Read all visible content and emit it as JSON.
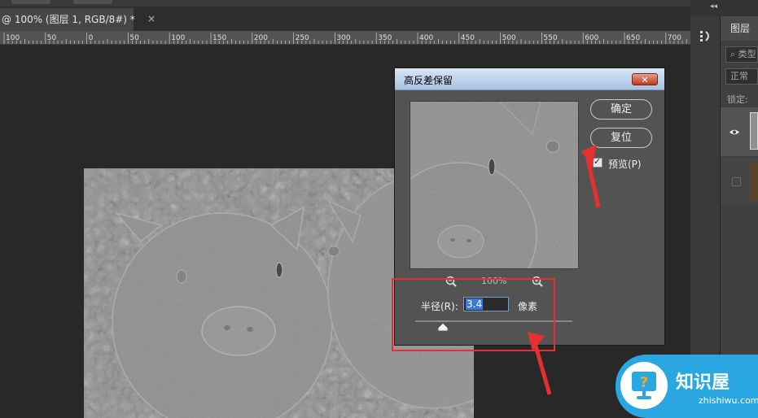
{
  "document": {
    "tab_label": "@ 100% (图层 1, RGB/8#) *",
    "close_glyph": "×"
  },
  "ruler": {
    "ticks": [
      "100",
      "50",
      "0",
      "50",
      "100",
      "150",
      "200",
      "250",
      "300",
      "350",
      "400",
      "450",
      "500",
      "550",
      "600",
      "650",
      "700"
    ]
  },
  "right_panel": {
    "collapse_glyph": "◂◂",
    "tab_label": "图层",
    "search_placeholder": "类型",
    "blend_mode": "正常",
    "lock_label": "锁定:"
  },
  "dialog": {
    "title": "高反差保留",
    "close_glyph": "✕",
    "ok_label": "确定",
    "reset_label": "复位",
    "preview_label": "预览(P)",
    "preview_checked": true,
    "zoom_level": "100%",
    "radius_label": "半径(R):",
    "radius_value": "3.4",
    "radius_unit": "像素",
    "slider_level": 0.17
  },
  "watermark": {
    "brand": "知识屋",
    "site": "zhishiwu.com"
  },
  "colors": {
    "canvas_bg": "#282828",
    "dialog_bg": "#535353",
    "titlebar": "#bcd3ee",
    "annotation_red": "#e53030",
    "watermark_blue": "#2aa7e0",
    "selection_blue": "#3b7ad8"
  }
}
